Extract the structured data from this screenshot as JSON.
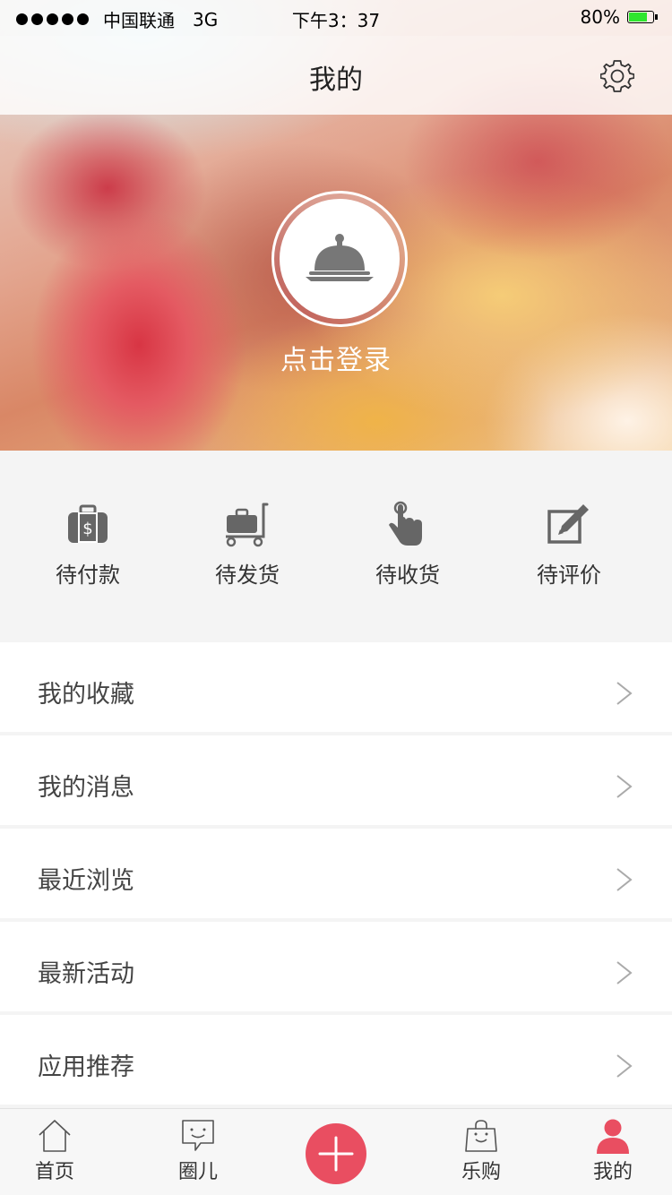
{
  "status_bar": {
    "carrier": "中国联通",
    "network": "3G",
    "time": "下午3：37",
    "battery": "80%",
    "battery_level": 0.8,
    "battery_color": "#2ee62e"
  },
  "nav": {
    "title": "我的",
    "settings_icon": "gear-icon"
  },
  "profile": {
    "avatar_icon": "food-cloche-icon",
    "login_label": "点击登录"
  },
  "orders": [
    {
      "label": "待付款",
      "icon": "wallet-icon"
    },
    {
      "label": "待发货",
      "icon": "luggage-cart-icon"
    },
    {
      "label": "待收货",
      "icon": "hand-pointer-icon"
    },
    {
      "label": "待评价",
      "icon": "edit-icon"
    }
  ],
  "menu": [
    {
      "label": "我的收藏"
    },
    {
      "label": "我的消息"
    },
    {
      "label": "最近浏览"
    },
    {
      "label": "最新活动"
    },
    {
      "label": "应用推荐"
    }
  ],
  "tabbar": {
    "home": "首页",
    "circle": "圈儿",
    "add_icon": "plus-icon",
    "shop": "乐购",
    "mine": "我的",
    "active_color": "#e94e61"
  }
}
